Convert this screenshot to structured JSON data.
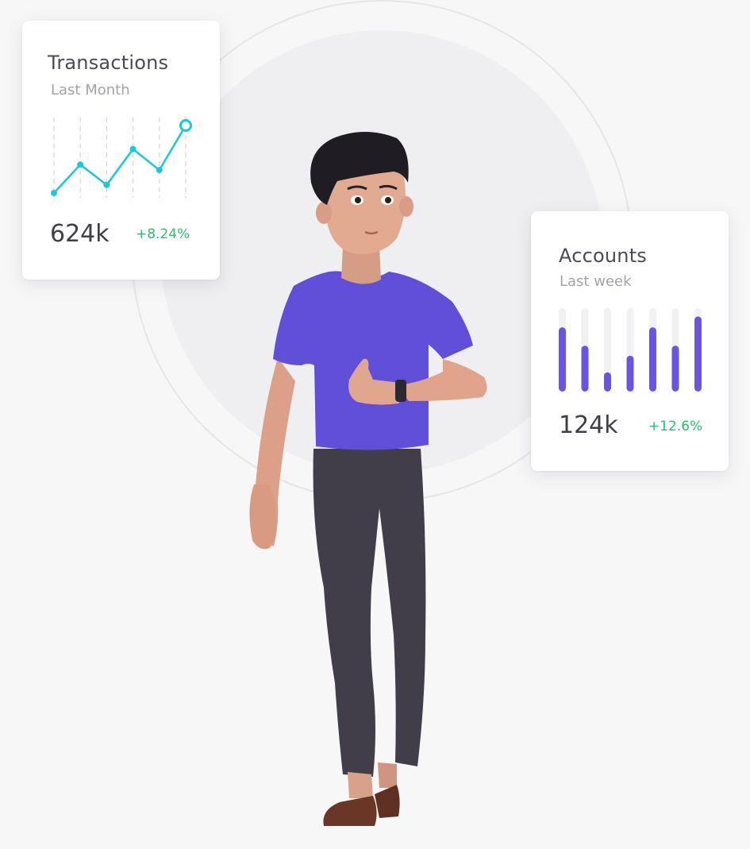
{
  "colors": {
    "line_accent": "#1cc9d8",
    "bar_accent": "#6a55e0",
    "bar_track": "#f1f1f4",
    "positive_change": "#2ebd6b",
    "shirt": "#6050dc",
    "pants": "#403c48",
    "skin": "#e0a48a",
    "hair": "#1e1c20"
  },
  "cards": {
    "transactions": {
      "title": "Transactions",
      "subtitle": "Last Month",
      "value": "624k",
      "change": "+8.24%"
    },
    "accounts": {
      "title": "Accounts",
      "subtitle": "Last week",
      "value": "124k",
      "change": "+12.6%"
    }
  },
  "illustration": {
    "subject": "3d-avatar-man-checking-watch"
  },
  "chart_data": [
    {
      "type": "line",
      "x": [
        1,
        2,
        3,
        4,
        5,
        6
      ],
      "values": [
        0,
        0.42,
        0.12,
        0.65,
        0.34,
        1.0
      ],
      "ylim": [
        0,
        1
      ],
      "grid": "vertical-dashed",
      "last_point_highlighted": true
    },
    {
      "type": "bar",
      "categories": [
        "1",
        "2",
        "3",
        "4",
        "5",
        "6",
        "7"
      ],
      "values": [
        0.77,
        0.55,
        0.23,
        0.43,
        0.77,
        0.55,
        0.9
      ],
      "ylim": [
        0,
        1
      ]
    }
  ]
}
